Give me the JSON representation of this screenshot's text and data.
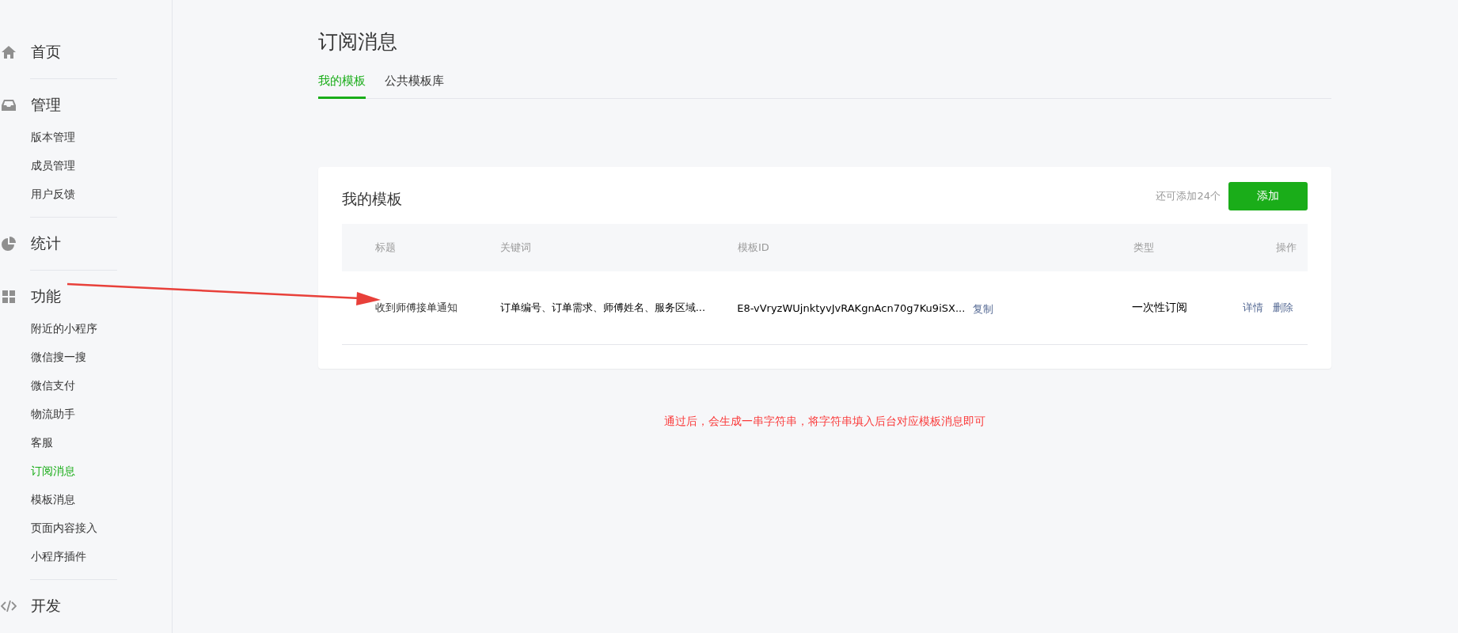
{
  "sidebar": {
    "sections": [
      {
        "label": "首页"
      },
      {
        "label": "管理",
        "children": [
          {
            "label": "版本管理",
            "selected": false
          },
          {
            "label": "成员管理",
            "selected": false
          },
          {
            "label": "用户反馈",
            "selected": false
          }
        ]
      },
      {
        "label": "统计"
      },
      {
        "label": "功能",
        "children": [
          {
            "label": "附近的小程序",
            "selected": false
          },
          {
            "label": "微信搜一搜",
            "selected": false
          },
          {
            "label": "微信支付",
            "selected": false
          },
          {
            "label": "物流助手",
            "selected": false
          },
          {
            "label": "客服",
            "selected": false
          },
          {
            "label": "订阅消息",
            "selected": true
          },
          {
            "label": "模板消息",
            "selected": false
          },
          {
            "label": "页面内容接入",
            "selected": false
          },
          {
            "label": "小程序插件",
            "selected": false
          }
        ]
      },
      {
        "label": "开发"
      }
    ]
  },
  "page": {
    "title": "订阅消息",
    "tabs": [
      {
        "label": "我的模板",
        "selected": true
      },
      {
        "label": "公共模板库",
        "selected": false
      }
    ],
    "card": {
      "title": "我的模板",
      "remaining": "还可添加24个",
      "add_button": "添加",
      "table": {
        "columns": [
          "标题",
          "关键词",
          "模板ID",
          "类型",
          "操作"
        ],
        "rows": [
          {
            "title": "收到师傅接单通知",
            "keywords": "订单编号、订单需求、师傅姓名、服务区域...",
            "template_id": "E8-vVryzWUjnktyvJvRAKgnAcn70g7Ku9iSX...",
            "copy": "复制",
            "type": "一次性订阅",
            "actions": [
              "详情",
              "删除"
            ]
          }
        ]
      }
    },
    "note": "通过后，会生成一串字符串，将字符串填入后台对应模板消息即可"
  }
}
